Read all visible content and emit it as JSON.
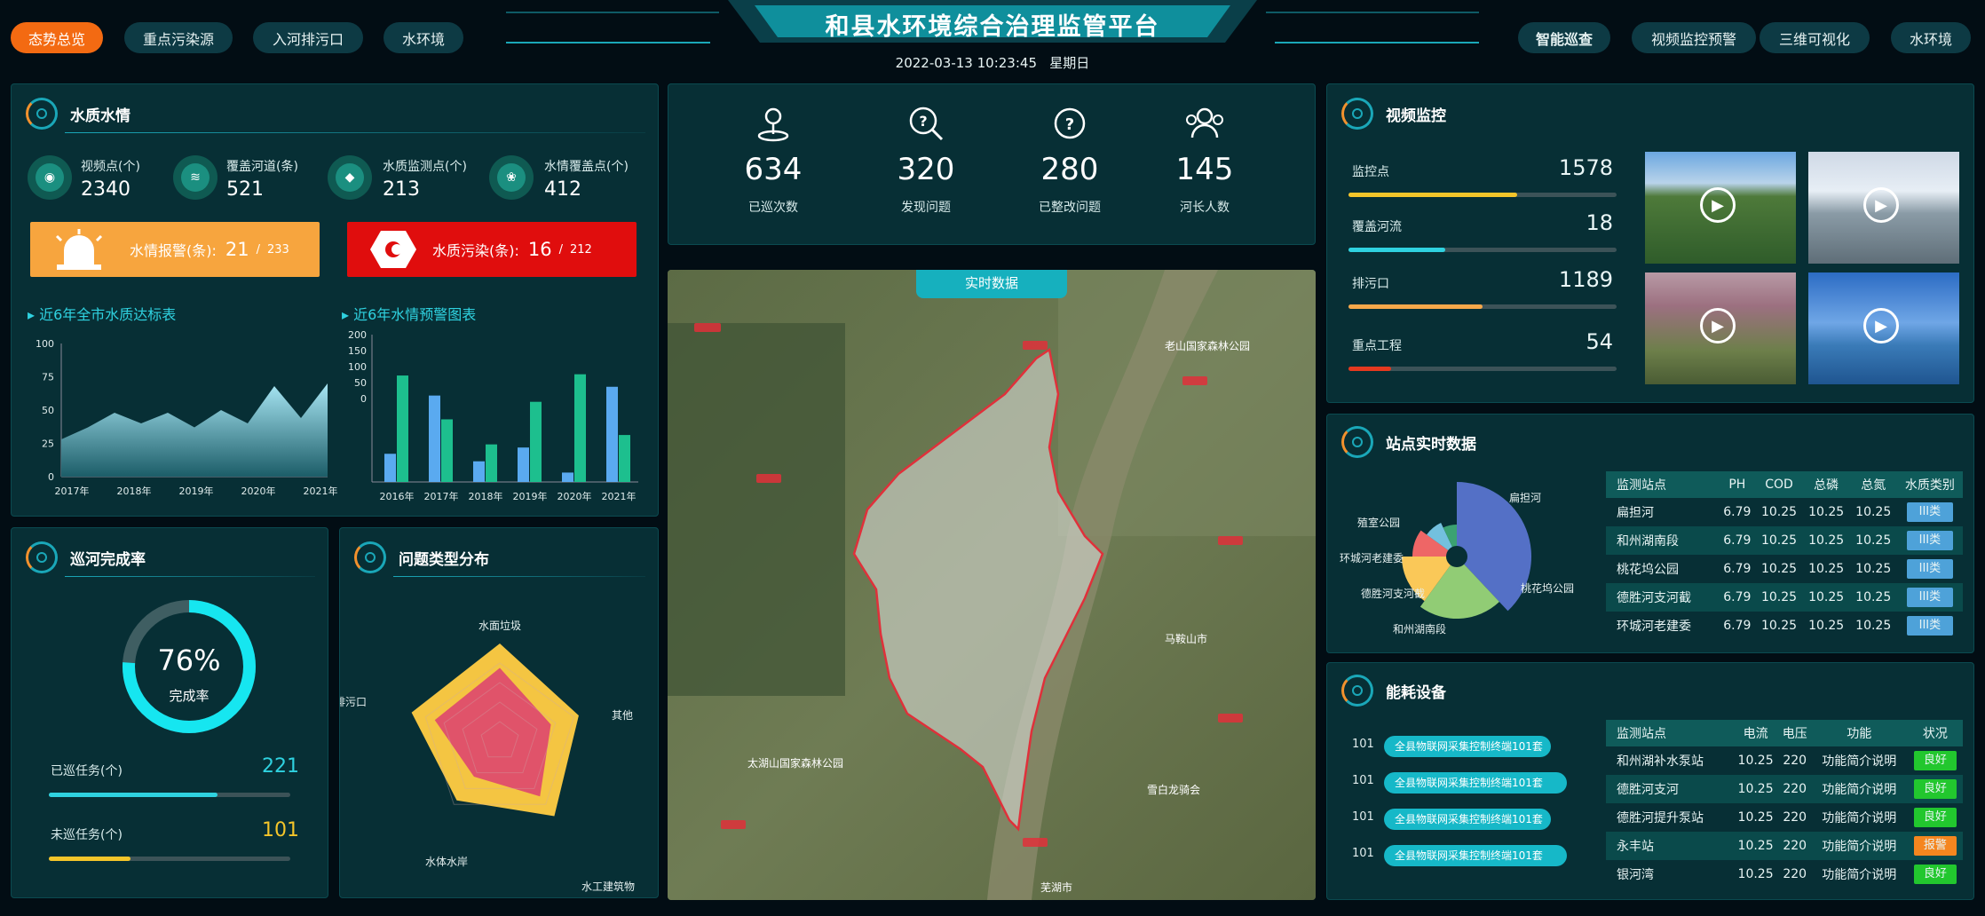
{
  "header": {
    "title": "和县水环境综合治理监管平台",
    "datetime": "2022-03-13 10:23:45",
    "weekday": "星期日",
    "left_nav": [
      "态势总览",
      "重点污染源",
      "入河排污口",
      "水环境"
    ],
    "right_nav": [
      "智能巡查",
      "视频监控预警",
      "三维可视化",
      "水环境"
    ]
  },
  "water_quality": {
    "title": "水质水情",
    "stats": [
      {
        "label": "视频点(个)",
        "value": "2340",
        "icon": "camera-icon"
      },
      {
        "label": "覆盖河道(条)",
        "value": "521",
        "icon": "river-icon"
      },
      {
        "label": "水质监测点(个)",
        "value": "213",
        "icon": "water-drop-icon"
      },
      {
        "label": "水情覆盖点(个)",
        "value": "412",
        "icon": "water-level-icon"
      }
    ],
    "alarm": {
      "label": "水情报警(条):",
      "value": "21",
      "total": "233",
      "color": "#f7a53e"
    },
    "pollution": {
      "label": "水质污染(条):",
      "value": "16",
      "total": "212",
      "color": "#e00d0d"
    }
  },
  "patrol_summary": [
    {
      "value": "634",
      "label": "已巡次数",
      "icon": "person-pin-icon"
    },
    {
      "value": "320",
      "label": "发现问题",
      "icon": "search-question-icon"
    },
    {
      "value": "280",
      "label": "已整改问题",
      "icon": "question-circle-icon"
    },
    {
      "value": "145",
      "label": "河长人数",
      "icon": "group-icon"
    }
  ],
  "map": {
    "label": "实时数据"
  },
  "video": {
    "title": "视频监控",
    "rows": [
      {
        "label": "监控点",
        "value": "1578",
        "pct": 0.6,
        "color": "#f4c52a"
      },
      {
        "label": "覆盖河流",
        "value": "18",
        "pct": 0.36,
        "color": "#2fd2e0"
      },
      {
        "label": "排污口",
        "value": "1189",
        "pct": 0.5,
        "color": "#f6a84a"
      },
      {
        "label": "重点工程",
        "value": "54",
        "pct": 0.16,
        "color": "#e5391f"
      }
    ]
  },
  "station": {
    "title": "站点实时数据",
    "headers": [
      "监测站点",
      "PH",
      "COD",
      "总磷",
      "总氮",
      "水质类别"
    ],
    "rows": [
      [
        "扁担河",
        "6.79",
        "10.25",
        "10.25",
        "10.25",
        "III类"
      ],
      [
        "和州湖南段",
        "6.79",
        "10.25",
        "10.25",
        "10.25",
        "III类"
      ],
      [
        "桃花坞公园",
        "6.79",
        "10.25",
        "10.25",
        "10.25",
        "III类"
      ],
      [
        "德胜河支河截",
        "6.79",
        "10.25",
        "10.25",
        "10.25",
        "III类"
      ],
      [
        "环城河老建委",
        "6.79",
        "10.25",
        "10.25",
        "10.25",
        "III类"
      ]
    ],
    "pie_labels": [
      "扁担河",
      "桃花坞公园",
      "和州湖南段",
      "德胜河支河截",
      "环城河老建委",
      "殖室公园"
    ]
  },
  "energy": {
    "title": "能耗设备",
    "device_label": "全县物联网采集控制终端101套",
    "device_nums": [
      "101",
      "101",
      "101",
      "101"
    ],
    "headers": [
      "监测站点",
      "电流",
      "电压",
      "功能",
      "状况"
    ],
    "rows": [
      [
        "和州湖补水泵站",
        "10.25",
        "220",
        "功能简介说明",
        "良好"
      ],
      [
        "德胜河支河",
        "10.25",
        "220",
        "功能简介说明",
        "良好"
      ],
      [
        "德胜河提升泵站",
        "10.25",
        "220",
        "功能简介说明",
        "良好"
      ],
      [
        "永丰站",
        "10.25",
        "220",
        "功能简介说明",
        "报警"
      ],
      [
        "银河湾",
        "10.25",
        "220",
        "功能简介说明",
        "良好"
      ]
    ]
  },
  "patrol_rate": {
    "title": "巡河完成率",
    "percent": "76%",
    "label": "完成率",
    "done_label": "已巡任务(个)",
    "done_value": "221",
    "undone_label": "未巡任务(个)",
    "undone_value": "101",
    "rate": 0.76
  },
  "issue_dist": {
    "title": "问题类型分布",
    "labels": [
      "水面垃圾",
      "其他",
      "水工建筑物",
      "水体水岸",
      "排污口"
    ]
  },
  "chart_data": [
    {
      "type": "area",
      "title": "近6年全市水质达标表",
      "x": [
        "2017年",
        "2018年",
        "2019年",
        "2020年",
        "2021年"
      ],
      "ylim": [
        0,
        100
      ],
      "yticks": [
        "0",
        "25",
        "50",
        "75",
        "100"
      ],
      "values": [
        28,
        37,
        48,
        40,
        48,
        37,
        50,
        40,
        68,
        44,
        70
      ]
    },
    {
      "type": "bar",
      "title": "近6年水情预警图表",
      "categories": [
        "2016年",
        "2017年",
        "2018年",
        "2019年",
        "2020年",
        "2021年"
      ],
      "yticks": [
        "0",
        "50",
        "100",
        "150",
        "200"
      ],
      "series": [
        {
          "values": [
            45,
            138,
            33,
            55,
            -15,
            152
          ],
          "color": "#5aaaf0"
        },
        {
          "values": [
            170,
            100,
            60,
            128,
            172,
            75
          ],
          "color": "#1dbf8e"
        }
      ]
    },
    {
      "type": "radar",
      "labels": [
        "水面垃圾",
        "其他",
        "水工建筑物",
        "水体水岸",
        "排污口"
      ],
      "series": [
        {
          "values": [
            1.0,
            0.85,
            0.95,
            0.75,
            0.95
          ],
          "color": "#f4c542"
        },
        {
          "values": [
            0.75,
            0.55,
            0.7,
            0.45,
            0.7
          ],
          "color": "#e0536a"
        }
      ]
    },
    {
      "type": "pie",
      "labels": [
        "扁担河",
        "桃花坞公园",
        "和州湖南段",
        "德胜河支河截",
        "环城河老建委",
        "殖室公园"
      ],
      "values": [
        38,
        22,
        15,
        10,
        8,
        7
      ],
      "colors": [
        "#5470c6",
        "#91cc75",
        "#fac858",
        "#ee6666",
        "#73c0de",
        "#3ba272"
      ]
    }
  ]
}
